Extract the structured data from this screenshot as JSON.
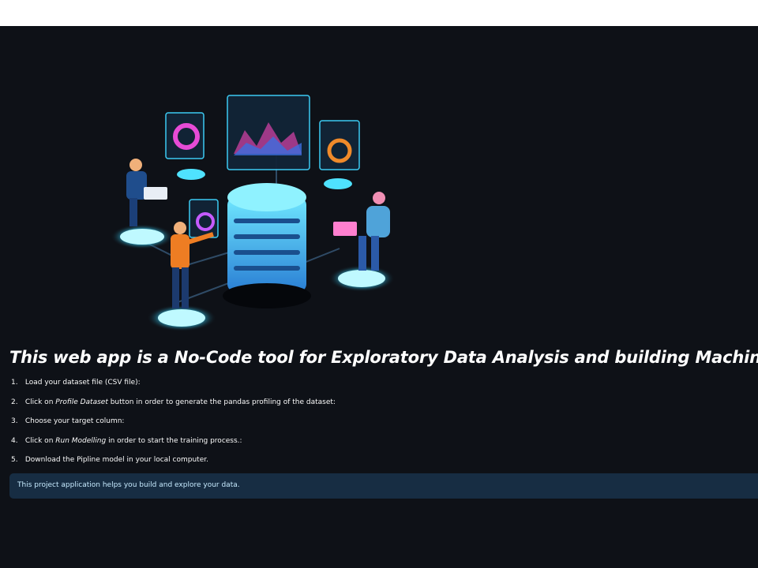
{
  "headline": "This web app is a No-Code tool for Exploratory Data Analysis and building Machine Learning model for Regression",
  "steps": [
    {
      "number": "1.",
      "text": "Load your dataset file (CSV file):"
    },
    {
      "number": "2.",
      "prefix": "Click on ",
      "emphasis": "Profile Dataset",
      "suffix": " button in order to generate the pandas profiling of the dataset:"
    },
    {
      "number": "3.",
      "text": "Choose your target column:"
    },
    {
      "number": "4.",
      "prefix": "Click on ",
      "emphasis": "Run Modelling",
      "suffix": " in order to start the training process.:"
    },
    {
      "number": "5.",
      "text": "Download the Pipline model in your local computer."
    }
  ],
  "info": {
    "text": "This project application helps you build and explore your data."
  },
  "hero_image": "data-center-illustration",
  "colors": {
    "background": "#0e1117",
    "info_box": "#172d43",
    "info_text": "#c7ebff",
    "accent_cyan": "#39d0ff"
  }
}
